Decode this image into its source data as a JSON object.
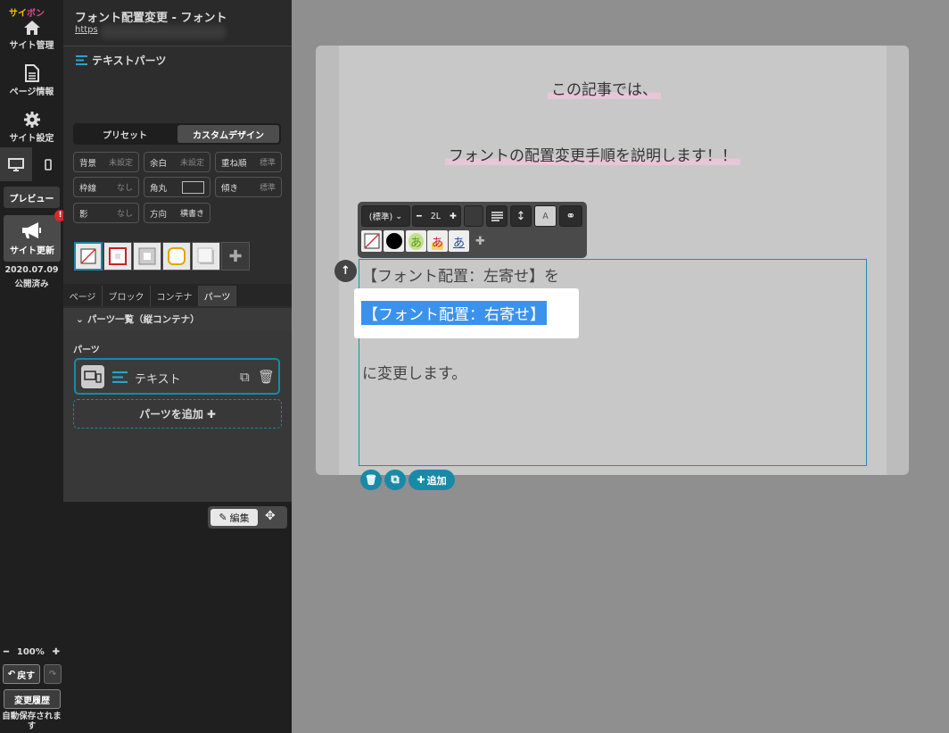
{
  "rail": {
    "logo_a": "サイ",
    "logo_b": "ボン",
    "site_admin": "サイト管理",
    "page_info": "ページ情報",
    "site_settings": "サイト設定",
    "preview": "プレビュー",
    "site_update": "サイト更新",
    "update_badge": "!",
    "publish_date": "2020.07.09",
    "publish_status": "公開済み",
    "zoom_level": "100%",
    "undo": "戻す",
    "history": "変更履歴",
    "autosave": "自動保存されます"
  },
  "panel": {
    "page_title": "フォント配置変更 - フォント",
    "page_url": "https",
    "section_title": "テキストパーツ",
    "mode_tabs": [
      "プリセット",
      "カスタムデザイン"
    ],
    "props": {
      "bg": {
        "label": "背景",
        "value": "未設定"
      },
      "margin": {
        "label": "余白",
        "value": "未設定"
      },
      "stack": {
        "label": "重ね順",
        "value": "標準"
      },
      "border": {
        "label": "枠線",
        "value": "なし"
      },
      "radius": {
        "label": "角丸",
        "value": ""
      },
      "tilt": {
        "label": "傾き",
        "value": "標準"
      },
      "shadow": {
        "label": "影",
        "value": "なし"
      },
      "direction": {
        "label": "方向",
        "value": "横書き"
      }
    },
    "tabs": [
      "ページ",
      "ブロック",
      "コンテナ",
      "パーツ"
    ],
    "parts_list_header": "パーツ一覧（縦コンテナ）",
    "parts_label": "パーツ",
    "part_item": "テキスト",
    "add_part": "パーツを追加",
    "edit_label": "編集"
  },
  "canvas": {
    "line1": "この記事では、",
    "line2": "フォントの配置変更手順を説明します！！",
    "para1": "【フォント配置：左寄せ】を",
    "para2_selected": "【フォント配置：右寄せ】",
    "para3": "に変更します。",
    "toolbar": {
      "font_select": "(標準)",
      "size_value": "2L",
      "color_label": "A",
      "glyph": "あ"
    },
    "add_label": "追加"
  },
  "colors": {
    "accent": "#1989a8",
    "selection": "#3b92ed",
    "highlight": "#e9c5d8",
    "badge": "#d9262c"
  }
}
